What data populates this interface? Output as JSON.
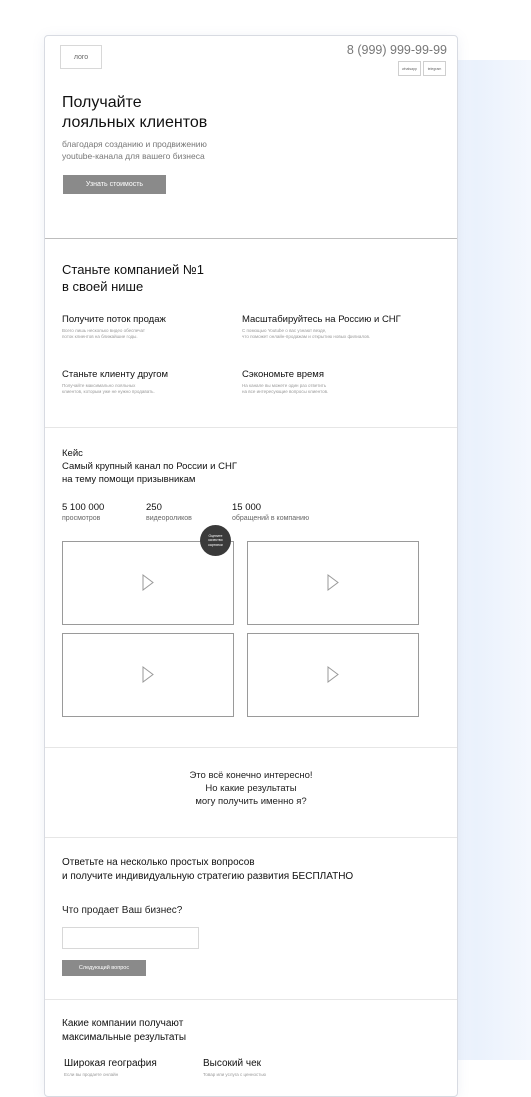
{
  "header": {
    "logo": "лого",
    "phone": "8 (999) 999-99-99",
    "messengers": [
      "whatsapp",
      "telegram"
    ]
  },
  "hero": {
    "title_line1": "Получайте",
    "title_line2": "лояльных клиентов",
    "sub_line1": "благодаря созданию и продвижению",
    "sub_line2": "youtube-канала для вашего бизнеса",
    "cta": "Узнать стоимость"
  },
  "benefits": {
    "title_line1": "Станьте компанией №1",
    "title_line2": "в своей нише",
    "items": [
      {
        "title": "Получите поток продаж",
        "desc1": "Всего лишь несколько видео обеспечат",
        "desc2": "поток клиентов на ближайшие годы."
      },
      {
        "title": "Масштабируйтесь на Россию и СНГ",
        "desc1": "С помощью Youtube о вас узнают везде,",
        "desc2": "что поможет онлайн-продажам и открытию новых филиалов."
      },
      {
        "title": "Станьте клиенту другом",
        "desc1": "Получайте максимально лояльных",
        "desc2": "клиентов, которым уже не нужно продавать."
      },
      {
        "title": "Сэкономьте время",
        "desc1": "На канале вы можете один раз ответить",
        "desc2": "на все интересующие вопросы клиентов."
      }
    ]
  },
  "case": {
    "label": "Кейс",
    "title_line1": "Самый крупный канал по России и СНГ",
    "title_line2": "на тему помощи призывникам",
    "stats": [
      {
        "value": "5 100 000",
        "label": "просмотров"
      },
      {
        "value": "250",
        "label": "видеороликов"
      },
      {
        "value": "15 000",
        "label": "обращений в компанию"
      }
    ],
    "badge_line1": "Оцените",
    "badge_line2": "качество",
    "badge_line3": "картинки"
  },
  "interest": {
    "line1": "Это всё конечно интересно!",
    "line2": "Но какие результаты",
    "line3": "могу получить именно я?"
  },
  "quiz": {
    "title_line1": "Ответьте на несколько простых вопросов",
    "title_line2": "и получите индивидуальную стратегию развития БЕСПЛАТНО",
    "question": "Что продает Ваш бизнес?",
    "input_value": "",
    "next": "Следующий вопрос"
  },
  "results": {
    "title_line1": "Какие компании получают",
    "title_line2": "максимальные результаты",
    "items": [
      {
        "title": "Широкая география",
        "desc": "Если вы продаете онлайн"
      },
      {
        "title": "Высокий чек",
        "desc": "Товар или услуга с ценностью"
      }
    ]
  }
}
